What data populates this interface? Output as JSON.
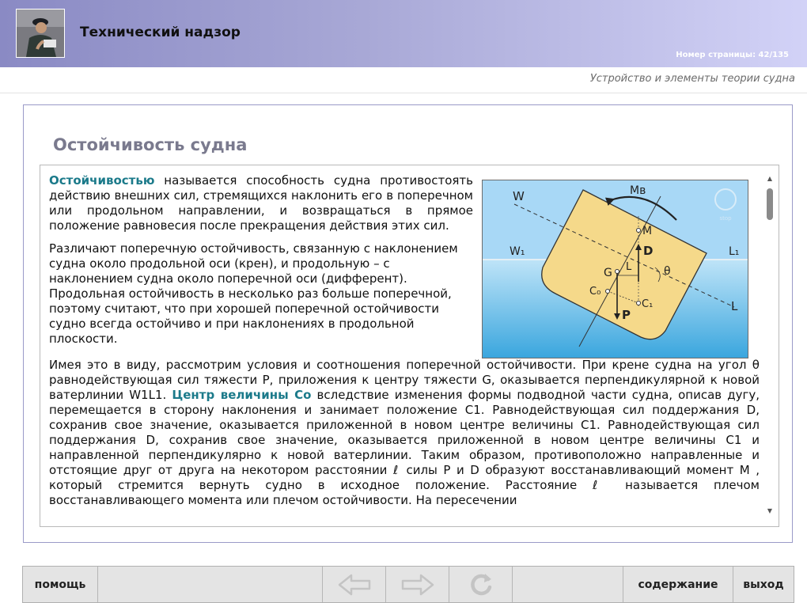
{
  "header": {
    "title": "Технический надзор",
    "page_number": "Номер страницы: 42/135"
  },
  "section_subtitle": "Устройство и элементы теории судна",
  "page_title": "Остойчивость судна",
  "content": {
    "p1_term": "Остойчивостью",
    "p1_text": " называется способность судна противостоять действию внешних сил, стремящихся наклонить его в поперечном или продольном направлении, и возвращаться в прямое положение равновесия после прекращения действия этих сил.",
    "p2_text": "Различают поперечную остойчивость, связанную с наклонением судна около продольной оси (крен), и продольную – с наклонением судна около поперечной оси (дифферент). Продольная остойчивость в несколько раз больше поперечной, поэтому считают, что при хорошей поперечной остойчивости судно всегда остойчиво и при наклонениях в продольной плоскости.",
    "p3_text_a": "Имея это в виду, рассмотрим условия и соотношения поперечной остойчивости. При крене судна на угол θ равнодействующая сил тяжести P, приложения к центру тяжести G, оказывается перпендикулярной к новой ватерлинии W1L1. ",
    "p3_term": "Центр величины Co",
    "p3_text_b": " вследствие изменения формы подводной части судна, описав дугу, перемещается в сторону наклонения и занимает положение C1. Равнодействующая сил поддержания D, сохранив свое значение, оказывается приложенной в новом центре величины C1. Равнодействующая сил поддержания D, сохранив свое значение, оказывается приложенной в новом центре величины C1 и направленной перпендикулярно к новой ватерлинии. Таким образом, противоположно направленные и отстоящие друг от друга на некотором расстоянии ℓ силы P и D образуют восстанавливающий момент M , который стремится вернуть судно в исходное положение. Расстояние ℓ называется плечом восстанавливающего момента или плечом остойчивости. На пересечении"
  },
  "figure": {
    "labels": {
      "W": "W",
      "W1": "W₁",
      "L1": "L₁",
      "L": "L",
      "Mv": "Mв",
      "M": "M",
      "D": "D",
      "G": "G",
      "l": "L",
      "theta": "θ",
      "C0": "C₀",
      "C1": "C₁",
      "P": "P"
    },
    "watermark": "stop"
  },
  "footer": {
    "help": "помощь",
    "contents": "содержание",
    "exit": "выход"
  },
  "icons": {
    "back": "arrow-left-icon",
    "forward": "arrow-right-icon",
    "reload": "reload-icon"
  },
  "colors": {
    "term": "#1b7a8a",
    "sky": "#a8d8f6",
    "water": "#56b6e6",
    "hull": "#f5d98a"
  }
}
